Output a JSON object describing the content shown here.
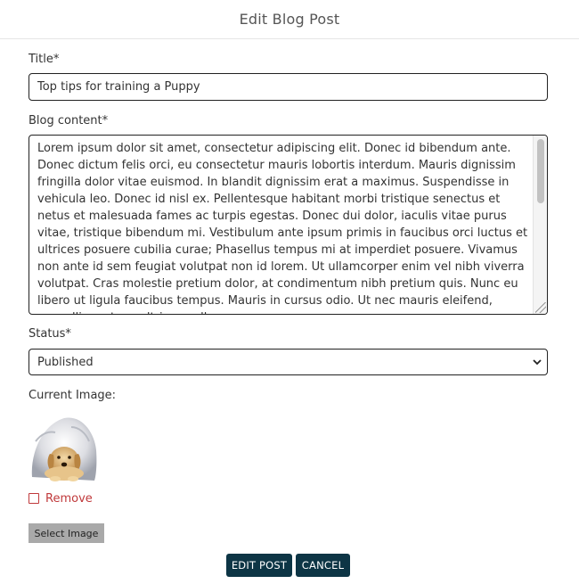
{
  "header": {
    "title": "Edit Blog Post"
  },
  "form": {
    "title_label": "Title*",
    "title_value": "Top tips for training a Puppy",
    "content_label": "Blog content*",
    "content_value": "Lorem ipsum dolor sit amet, consectetur adipiscing elit. Donec id bibendum ante. Donec dictum felis orci, eu consectetur mauris lobortis interdum. Mauris dignissim fringilla dolor vitae euismod. In blandit dignissim erat a maximus. Suspendisse in vehicula leo. Donec id nisl ex. Pellentesque habitant morbi tristique senectus et netus et malesuada fames ac turpis egestas. Donec dui dolor, iaculis vitae purus vitae, tristique bibendum mi. Vestibulum ante ipsum primis in faucibus orci luctus et ultrices posuere cubilia curae; Phasellus tempus mi at imperdiet posuere. Vivamus non ante id sem feugiat volutpat non id lorem. Ut ullamcorper enim vel nibh viverra volutpat. Cras molestie pretium dolor, at condimentum nibh pretium quis. Nunc eu libero ut ligula faucibus tempus. Mauris in cursus odio. Ut nec mauris eleifend, convallis erat ac, ultrices nulla.",
    "status_label": "Status*",
    "status_value": "Published",
    "current_image_label": "Current Image:",
    "remove_label": "Remove",
    "select_image_label": "Select Image"
  },
  "actions": {
    "edit_label": "EDIT POST",
    "cancel_label": "CANCEL"
  },
  "icons": {
    "dropdown": "chevron-down-icon",
    "checkbox": "checkbox-icon",
    "image": "puppy-thumbnail"
  },
  "colors": {
    "primary_button": "#0d3545",
    "remove_text": "#c0393b",
    "select_button": "#a9a9a9"
  }
}
